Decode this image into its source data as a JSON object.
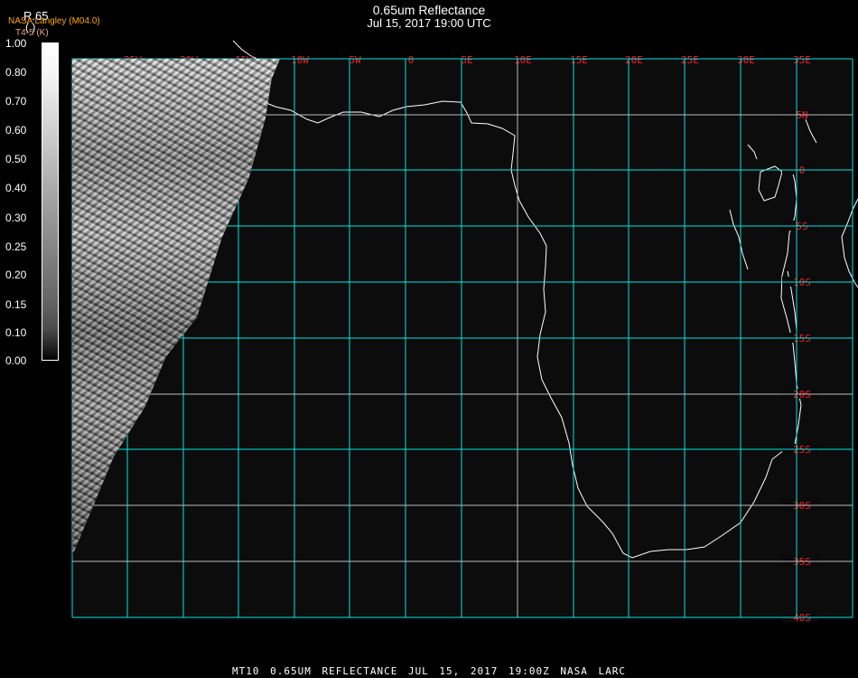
{
  "header": {
    "title": "0.65um Reflectance",
    "subtitle": "Jul 15, 2017 19:00 UTC"
  },
  "legend": {
    "channel": "R.65",
    "source": "NASA Langley (M04.0)",
    "paren": "(   )",
    "unit": "T4-5 (K)",
    "ticks": [
      "1.00",
      "0.80",
      "0.70",
      "0.60",
      "0.50",
      "0.40",
      "0.30",
      "0.25",
      "0.20",
      "0.15",
      "0.10",
      "0.00"
    ]
  },
  "map": {
    "lon_labels": [
      "25W",
      "20W",
      "15W",
      "10W",
      "5W",
      "0",
      "5E",
      "10E",
      "15E",
      "20E",
      "25E",
      "30E",
      "35E"
    ],
    "lat_labels": [
      "5N",
      "0",
      "5S",
      "10S",
      "15S",
      "20S",
      "25S",
      "30S",
      "35S",
      "40S"
    ],
    "grid_color": "#00e5e5",
    "label_color": "#ff2020"
  },
  "footer": {
    "text": "MT10  0.65UM REFLECTANCE   JUL 15, 2017 19:00Z   NASA LARC"
  }
}
